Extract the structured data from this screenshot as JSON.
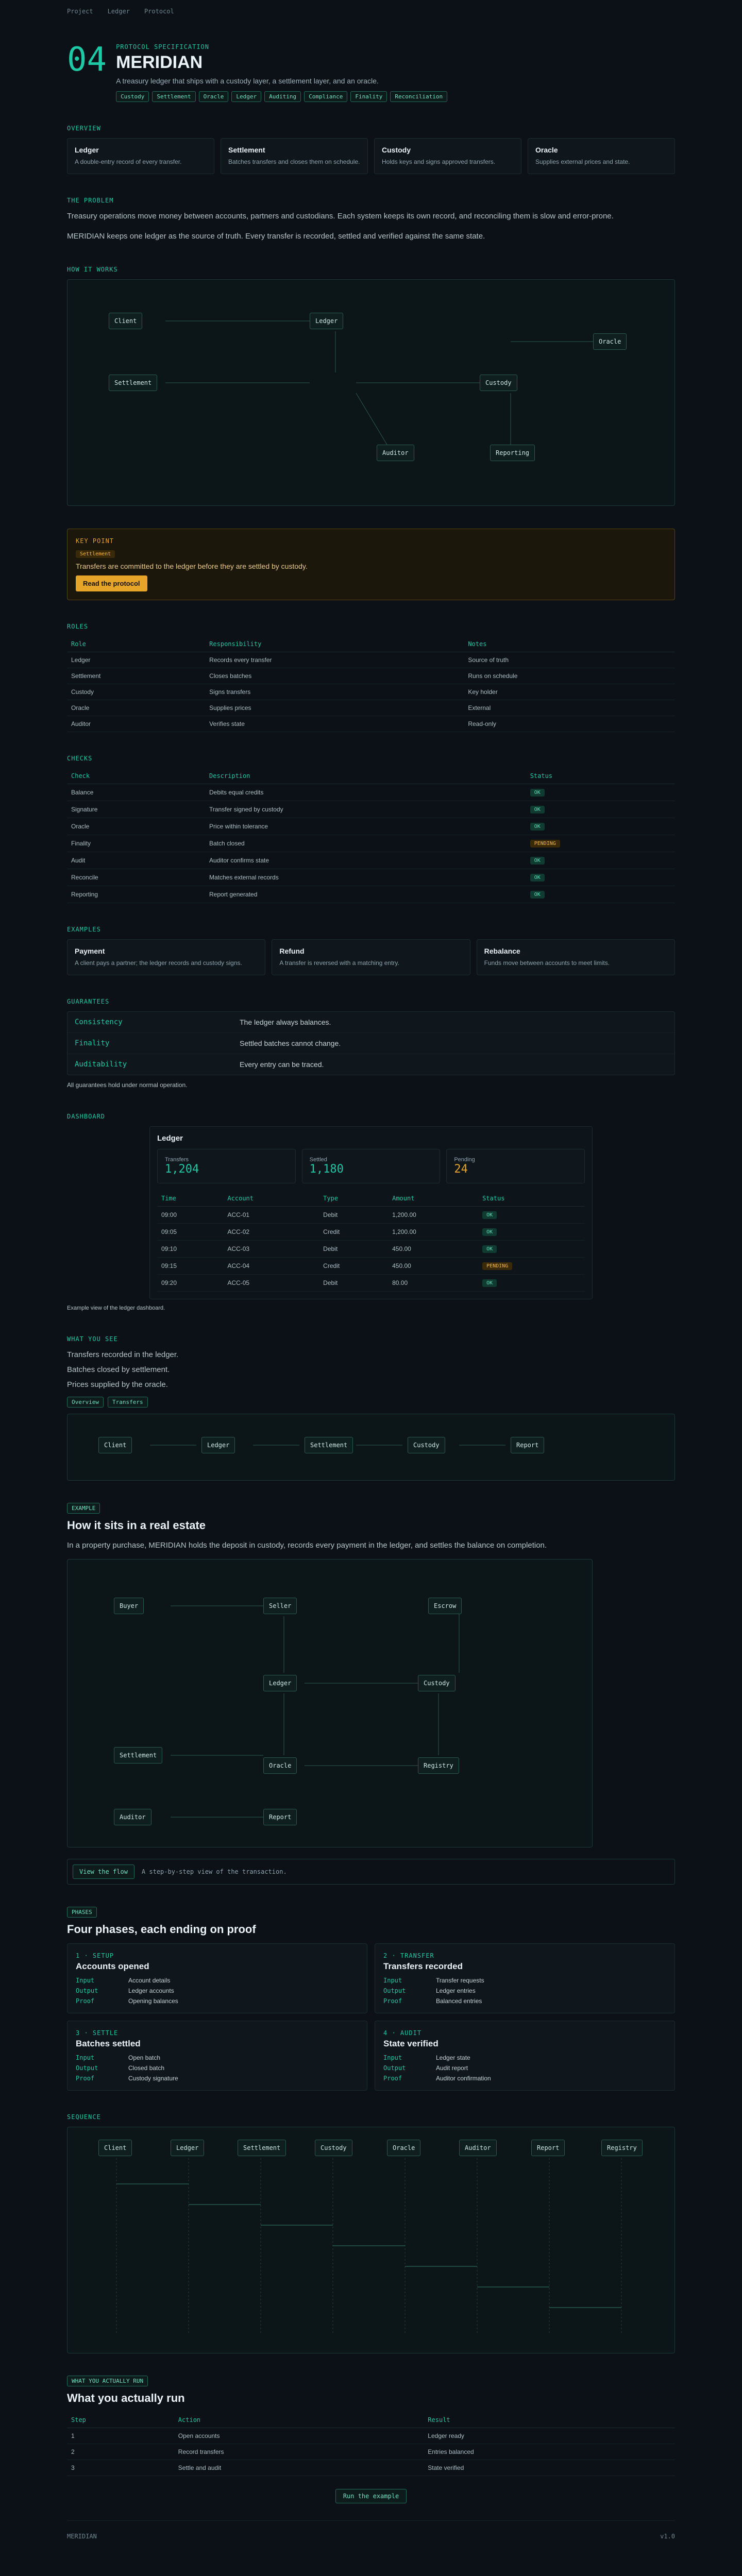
{
  "topbar": {
    "items": [
      "Project",
      "Ledger",
      "Protocol"
    ]
  },
  "hero": {
    "number": "04",
    "eyebrow": "PROTOCOL SPECIFICATION",
    "title": "MERIDIAN",
    "lede": "A treasury ledger that ships with a custody layer, a settlement layer, and an oracle.",
    "chips": [
      "Custody",
      "Settlement",
      "Oracle",
      "Ledger",
      "Auditing",
      "Compliance",
      "Finality",
      "Reconciliation"
    ]
  },
  "overview": {
    "label": "OVERVIEW",
    "cards": [
      {
        "title": "Ledger",
        "text": "A double-entry record of every transfer."
      },
      {
        "title": "Settlement",
        "text": "Batches transfers and closes them on schedule."
      },
      {
        "title": "Custody",
        "text": "Holds keys and signs approved transfers."
      },
      {
        "title": "Oracle",
        "text": "Supplies external prices and state."
      }
    ]
  },
  "problem": {
    "label": "THE PROBLEM",
    "paragraphs": [
      "Treasury operations move money between accounts, partners and custodians. Each system keeps its own record, and reconciling them is slow and error-prone.",
      "MERIDIAN keeps one ledger as the source of truth. Every transfer is recorded, settled and verified against the same state."
    ]
  },
  "diagram1": {
    "label": "HOW IT WORKS",
    "nodes": [
      "Client",
      "Ledger",
      "Settlement",
      "Custody",
      "Oracle",
      "Auditor",
      "Reporting"
    ]
  },
  "note": {
    "label": "KEY POINT",
    "tag": "Settlement",
    "text": "Transfers are committed to the ledger before they are settled by custody.",
    "button": "Read the protocol"
  },
  "roles": {
    "label": "ROLES",
    "headers": [
      "Role",
      "Responsibility",
      "Notes"
    ],
    "rows": [
      [
        "Ledger",
        "Records every transfer",
        "Source of truth"
      ],
      [
        "Settlement",
        "Closes batches",
        "Runs on schedule"
      ],
      [
        "Custody",
        "Signs transfers",
        "Key holder"
      ],
      [
        "Oracle",
        "Supplies prices",
        "External"
      ],
      [
        "Auditor",
        "Verifies state",
        "Read-only"
      ]
    ]
  },
  "checks": {
    "label": "CHECKS",
    "headers": [
      "Check",
      "Description",
      "Status"
    ],
    "rows": [
      [
        "Balance",
        "Debits equal credits",
        "OK"
      ],
      [
        "Signature",
        "Transfer signed by custody",
        "OK"
      ],
      [
        "Oracle",
        "Price within tolerance",
        "OK"
      ],
      [
        "Finality",
        "Batch closed",
        "PENDING"
      ],
      [
        "Audit",
        "Auditor confirms state",
        "OK"
      ],
      [
        "Reconcile",
        "Matches external records",
        "OK"
      ],
      [
        "Reporting",
        "Report generated",
        "OK"
      ]
    ]
  },
  "examples": {
    "label": "EXAMPLES",
    "cards": [
      {
        "title": "Payment",
        "text": "A client pays a partner; the ledger records and custody signs."
      },
      {
        "title": "Refund",
        "text": "A transfer is reversed with a matching entry."
      },
      {
        "title": "Rebalance",
        "text": "Funds move between accounts to meet limits."
      }
    ]
  },
  "guarantees": {
    "label": "GUARANTEES",
    "rows": [
      {
        "k": "Consistency",
        "v": "The ledger always balances."
      },
      {
        "k": "Finality",
        "v": "Settled batches cannot change."
      },
      {
        "k": "Auditability",
        "v": "Every entry can be traced."
      }
    ],
    "footnote": "All guarantees hold under normal operation."
  },
  "dashboard": {
    "label": "DASHBOARD",
    "title": "Ledger",
    "kpis": [
      {
        "label": "Transfers",
        "value": "1,204"
      },
      {
        "label": "Settled",
        "value": "1,180"
      },
      {
        "label": "Pending",
        "value": "24"
      }
    ],
    "headers": [
      "Time",
      "Account",
      "Type",
      "Amount",
      "Status"
    ],
    "rows": [
      [
        "09:00",
        "ACC-01",
        "Debit",
        "1,200.00",
        "OK"
      ],
      [
        "09:05",
        "ACC-02",
        "Credit",
        "1,200.00",
        "OK"
      ],
      [
        "09:10",
        "ACC-03",
        "Debit",
        "450.00",
        "OK"
      ],
      [
        "09:15",
        "ACC-04",
        "Credit",
        "450.00",
        "PENDING"
      ],
      [
        "09:20",
        "ACC-05",
        "Debit",
        "80.00",
        "OK"
      ]
    ],
    "caption": "Example view of the ledger dashboard."
  },
  "whatyousee": {
    "label": "WHAT YOU SEE",
    "lines": [
      "Transfers recorded in the ledger.",
      "Batches closed by settlement.",
      "Prices supplied by the oracle."
    ],
    "tabs": [
      "Overview",
      "Transfers"
    ]
  },
  "pipeline": {
    "nodes": [
      "Client",
      "Ledger",
      "Settlement",
      "Custody",
      "Report"
    ]
  },
  "realestate": {
    "label": "EXAMPLE",
    "title": "How it sits in a real estate",
    "text": "In a property purchase, MERIDIAN holds the deposit in custody, records every payment in the ledger, and settles the balance on completion.",
    "nodes": [
      "Buyer",
      "Seller",
      "Escrow",
      "Ledger",
      "Custody",
      "Settlement",
      "Oracle",
      "Registry",
      "Auditor",
      "Report"
    ]
  },
  "cta": {
    "button": "View the flow",
    "text": "A step-by-step view of the transaction."
  },
  "phases": {
    "label": "PHASES",
    "title": "Four phases, each ending on proof",
    "items": [
      {
        "num": "1",
        "tag": "SETUP",
        "title": "Accounts opened",
        "rows": [
          {
            "k": "Input",
            "v": "Account details"
          },
          {
            "k": "Output",
            "v": "Ledger accounts"
          },
          {
            "k": "Proof",
            "v": "Opening balances"
          }
        ]
      },
      {
        "num": "2",
        "tag": "TRANSFER",
        "title": "Transfers recorded",
        "rows": [
          {
            "k": "Input",
            "v": "Transfer requests"
          },
          {
            "k": "Output",
            "v": "Ledger entries"
          },
          {
            "k": "Proof",
            "v": "Balanced entries"
          }
        ]
      },
      {
        "num": "3",
        "tag": "SETTLE",
        "title": "Batches settled",
        "rows": [
          {
            "k": "Input",
            "v": "Open batch"
          },
          {
            "k": "Output",
            "v": "Closed batch"
          },
          {
            "k": "Proof",
            "v": "Custody signature"
          }
        ]
      },
      {
        "num": "4",
        "tag": "AUDIT",
        "title": "State verified",
        "rows": [
          {
            "k": "Input",
            "v": "Ledger state"
          },
          {
            "k": "Output",
            "v": "Audit report"
          },
          {
            "k": "Proof",
            "v": "Auditor confirmation"
          }
        ]
      }
    ]
  },
  "sequence": {
    "label": "SEQUENCE",
    "actors": [
      "Client",
      "Ledger",
      "Settlement",
      "Custody",
      "Oracle",
      "Auditor",
      "Report",
      "Registry"
    ]
  },
  "run": {
    "label": "WHAT YOU ACTUALLY RUN",
    "title": "What you actually run",
    "headers": [
      "Step",
      "Action",
      "Result"
    ],
    "rows": [
      [
        "1",
        "Open accounts",
        "Ledger ready"
      ],
      [
        "2",
        "Record transfers",
        "Entries balanced"
      ],
      [
        "3",
        "Settle and audit",
        "State verified"
      ]
    ],
    "button": "Run the example"
  },
  "footer": {
    "left": "MERIDIAN",
    "right": "v1.0"
  }
}
